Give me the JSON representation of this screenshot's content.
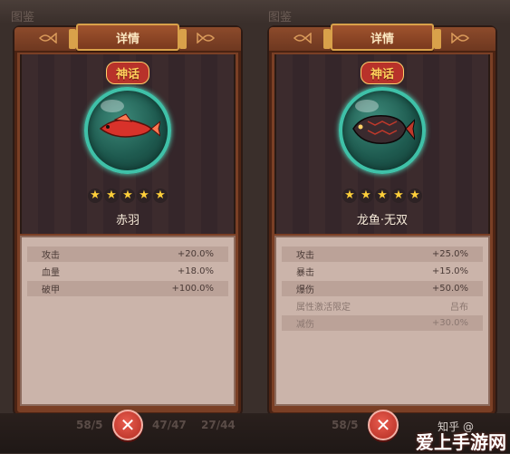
{
  "background": {
    "label_left": "图鉴",
    "label_right": "图鉴"
  },
  "panels": [
    {
      "title": "详情",
      "rarity": "神话",
      "fish_name": "赤羽",
      "stars": 5,
      "fish_colors": {
        "body": "#d8322a",
        "fin": "#ff7a52"
      },
      "stats": [
        {
          "label": "攻击",
          "value": "+20.0%",
          "dim": false
        },
        {
          "label": "血量",
          "value": "+18.0%",
          "dim": false
        },
        {
          "label": "破甲",
          "value": "+100.0%",
          "dim": false
        }
      ]
    },
    {
      "title": "详情",
      "rarity": "神话",
      "fish_name": "龙鱼·无双",
      "stars": 5,
      "fish_colors": {
        "body": "#3a2a2e",
        "fin": "#c0392b"
      },
      "stats": [
        {
          "label": "攻击",
          "value": "+25.0%",
          "dim": false
        },
        {
          "label": "暴击",
          "value": "+15.0%",
          "dim": false
        },
        {
          "label": "爆伤",
          "value": "+50.0%",
          "dim": false
        },
        {
          "label": "属性激活限定",
          "value": "吕布",
          "dim": true
        },
        {
          "label": "减伤",
          "value": "+30.0%",
          "dim": true
        }
      ]
    }
  ],
  "bottom": {
    "counter_left_a": "58/5",
    "counter_left_b": "47/47",
    "counter_left_c": "27/44",
    "counter_right_a": "58/5"
  },
  "close_label": "✕",
  "watermark": {
    "text": "知乎 @"
  },
  "brand": "爱上手游网",
  "colors": {
    "frame": "#7a3f25",
    "plaque_border": "#d9a14a",
    "rarity_bg": "#b8322a",
    "bubble_ring": "#3fc1a8",
    "star": "#ffcf3a",
    "stats_bg": "#cbb4aa"
  }
}
